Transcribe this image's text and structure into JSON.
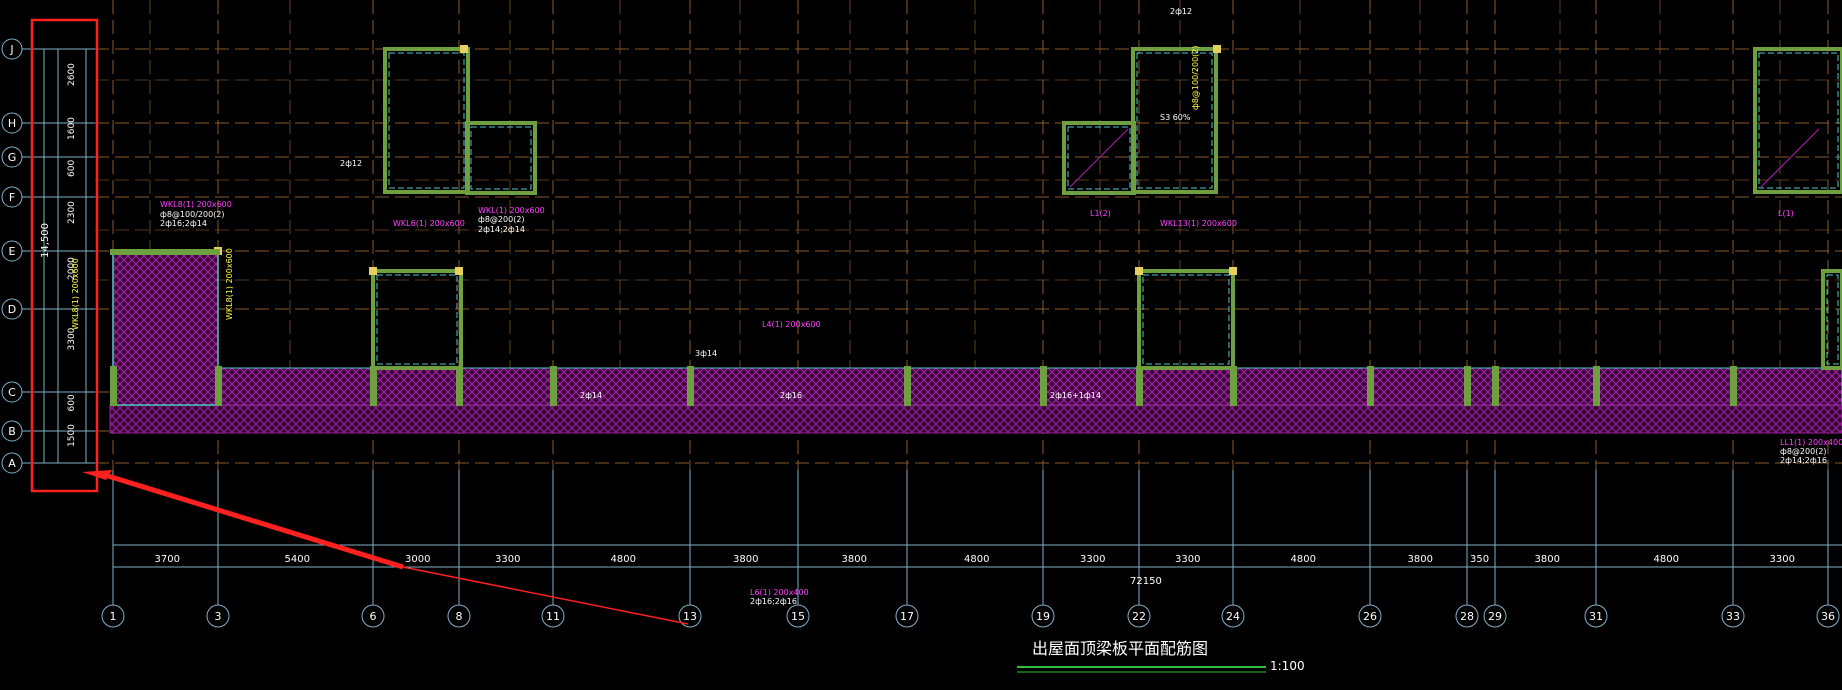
{
  "drawing": {
    "title": "出屋面顶梁板平面配筋图",
    "scale": "1:100",
    "overall_width": "72150",
    "overall_height": "14,500"
  },
  "colors": {
    "background": "#000000",
    "axis_line": "#8a5a2a",
    "dim_line": "#7fb0c8",
    "beam_outline": "#4fc8c8",
    "column_fill": "#6fa040",
    "slab_hatch": "#b020b0",
    "annot_magenta": "#ff40ff",
    "annot_white": "#ffffff",
    "annot_yellow": "#ffff40",
    "highlight": "#ff2020"
  },
  "row_axes": [
    "J",
    "H",
    "G",
    "F",
    "E",
    "D",
    "C",
    "B",
    "A"
  ],
  "row_dims": [
    "2600",
    "1600",
    "600",
    "2300",
    "2000",
    "3300",
    "600",
    "1500"
  ],
  "col_axes": [
    "1",
    "3",
    "6",
    "8",
    "11",
    "13",
    "15",
    "17",
    "19",
    "22",
    "24",
    "26",
    "28",
    "29",
    "31",
    "33",
    "36"
  ],
  "col_dims": [
    "3700",
    "5400",
    "3000",
    "3300",
    "4800",
    "3800",
    "3800",
    "4800",
    "3300",
    "3300",
    "4800",
    "3800",
    "350",
    "3800",
    "4800",
    "3300"
  ],
  "beam_labels": [
    {
      "text": "WKL8(1) 200x600",
      "kind": "name"
    },
    {
      "text": "ф8@100/200(2)",
      "kind": "stirrup"
    },
    {
      "text": "2ф16;2ф14",
      "kind": "rebar"
    },
    {
      "text": "WKL6(1) 200x600",
      "kind": "name"
    },
    {
      "text": "WKL(1) 200x600",
      "kind": "name"
    },
    {
      "text": "ф8@200(2)",
      "kind": "stirrup"
    },
    {
      "text": "2ф14;2ф14",
      "kind": "rebar"
    },
    {
      "text": "L4(1) 200x600",
      "kind": "name"
    },
    {
      "text": "L6(1) 200x400",
      "kind": "name"
    },
    {
      "text": "2ф16;2ф16",
      "kind": "rebar"
    },
    {
      "text": "WKL13(1) 200x600",
      "kind": "name"
    },
    {
      "text": "3ф14",
      "kind": "rebar"
    },
    {
      "text": "2ф14",
      "kind": "rebar"
    },
    {
      "text": "2ф16",
      "kind": "rebar"
    },
    {
      "text": "2ф16+1ф14",
      "kind": "rebar"
    },
    {
      "text": "LL1(1) 200x400",
      "kind": "name"
    },
    {
      "text": "ф8@200(2)",
      "kind": "stirrup"
    },
    {
      "text": "2ф14;2ф16",
      "kind": "rebar"
    },
    {
      "text": "2ф12",
      "kind": "rebar"
    },
    {
      "text": "L1(2)",
      "kind": "name"
    },
    {
      "text": "2ф12",
      "kind": "rebar"
    },
    {
      "text": "L(1)",
      "kind": "name"
    },
    {
      "text": "S3 60%",
      "kind": "rebar"
    }
  ]
}
